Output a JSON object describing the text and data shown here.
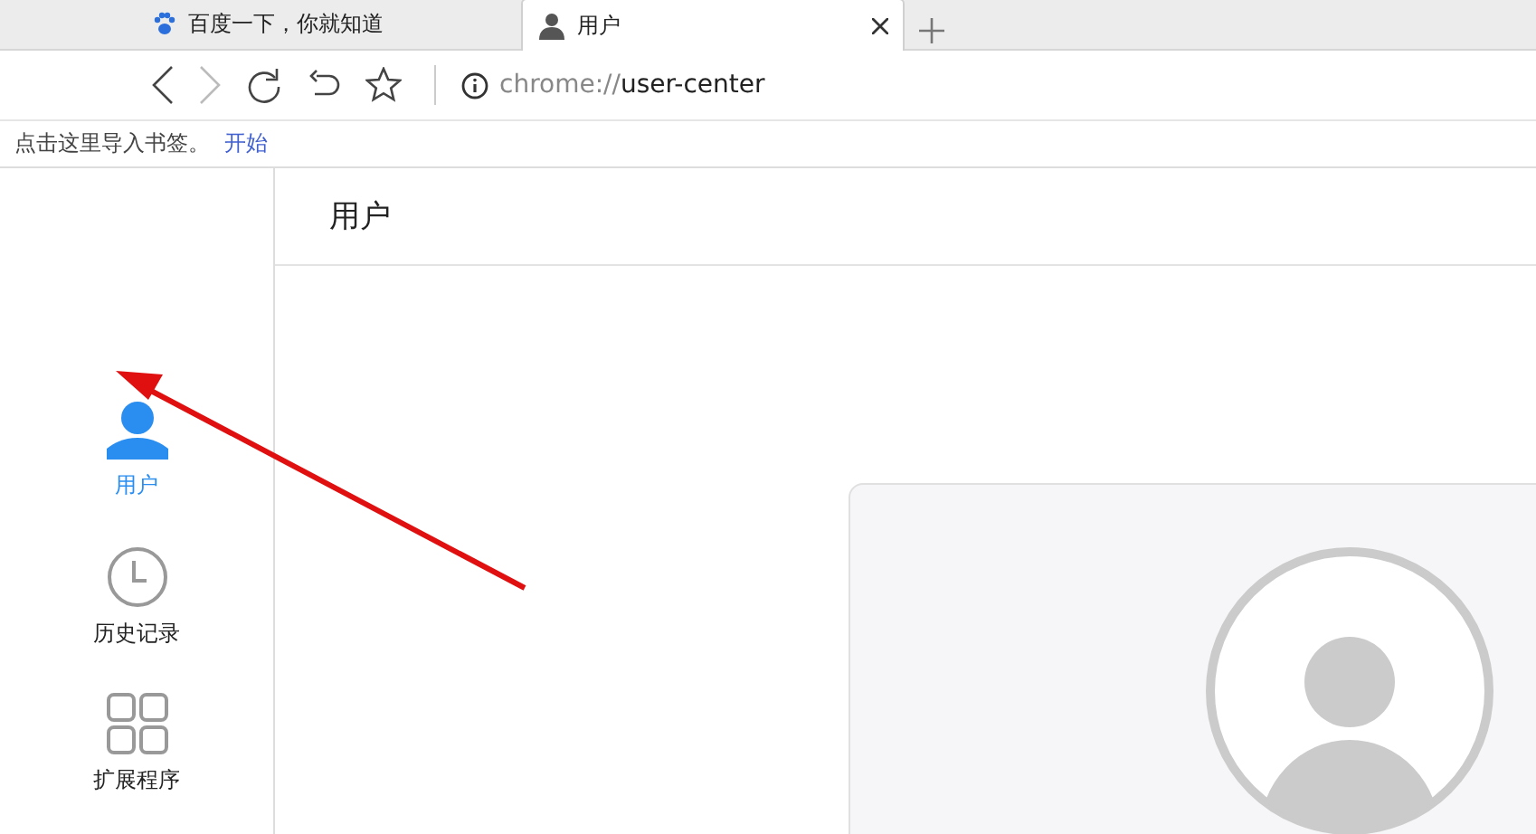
{
  "tabs": [
    {
      "title": "百度一下，你就知道",
      "kind": "paw",
      "selected": false
    },
    {
      "title": "用户",
      "kind": "person",
      "selected": true
    }
  ],
  "address_bar": {
    "scheme": "chrome://",
    "path": "user-center"
  },
  "bookmarks_bar": {
    "hint": "点击这里导入书签。",
    "link": "开始"
  },
  "sidebar": {
    "items": [
      {
        "label": "用户",
        "kind": "person",
        "selected": true
      },
      {
        "label": "历史记录",
        "kind": "clock",
        "selected": false
      },
      {
        "label": "扩展程序",
        "kind": "grid",
        "selected": false
      }
    ]
  },
  "page": {
    "title": "用户"
  }
}
